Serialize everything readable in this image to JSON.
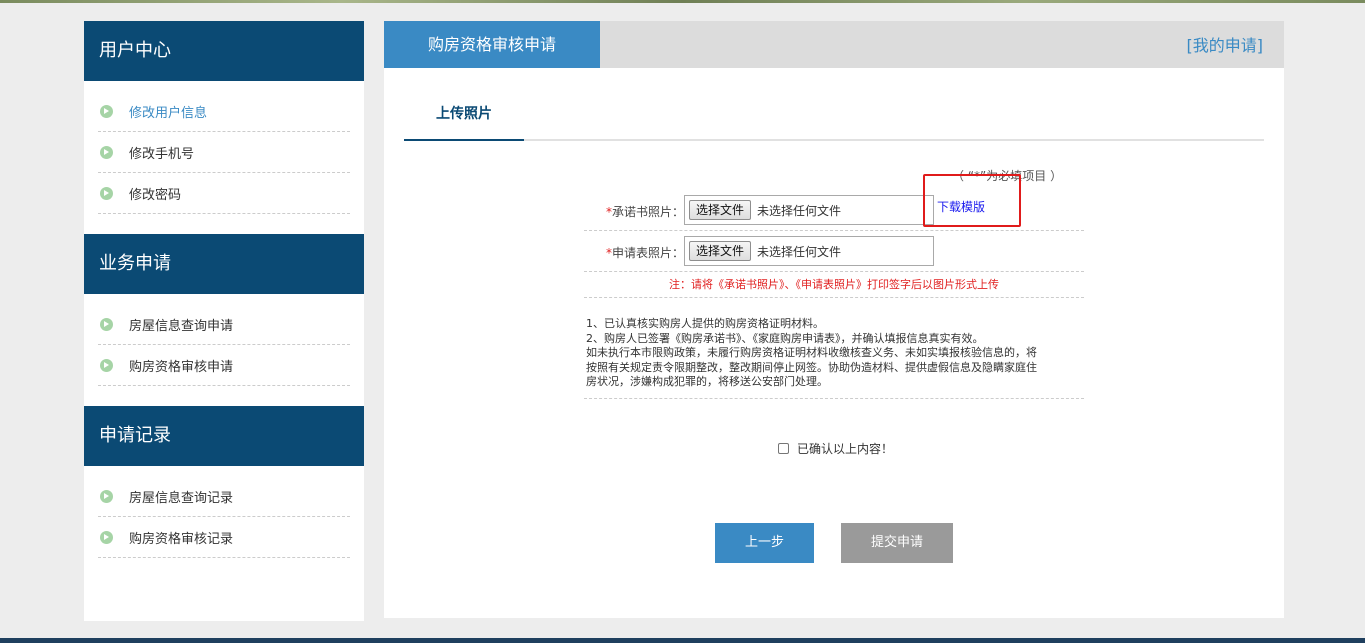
{
  "sidebar": {
    "sections": [
      {
        "title": "用户中心",
        "items": [
          "修改用户信息",
          "修改手机号",
          "修改密码"
        ]
      },
      {
        "title": "业务申请",
        "items": [
          "房屋信息查询申请",
          "购房资格审核申请"
        ]
      },
      {
        "title": "申请记录",
        "items": [
          "房屋信息查询记录",
          "购房资格审核记录"
        ]
      }
    ]
  },
  "main": {
    "tab_title": "购房资格审核申请",
    "my_apply": "[我的申请]",
    "subtab": "上传照片",
    "required_note": "（ “*”为必填项目 ）",
    "fields": [
      {
        "star": "*",
        "label": "承诺书照片：",
        "button": "选择文件",
        "status": "未选择任何文件"
      },
      {
        "star": "*",
        "label": "申请表照片：",
        "button": "选择文件",
        "status": "未选择任何文件"
      }
    ],
    "download_link": "下载模版",
    "warning": "注：请将《承诺书照片》、《申请表照片》打印签字后以图片形式上传",
    "notice_lines": [
      "1、已认真核实购房人提供的购房资格证明材料。",
      "2、购房人已签署《购房承诺书》、《家庭购房申请表》，并确认填报信息真实有效。",
      "如未执行本市限购政策，未履行购房资格证明材料收缴核查义务、未如实填报核验信息的，将",
      "按照有关规定责令限期整改，整改期间停止网签。协助伪造材料、提供虚假信息及隐瞒家庭住",
      "房状况，涉嫌构成犯罪的，将移送公安部门处理。"
    ],
    "confirm_label": "已确认以上内容！",
    "prev_button": "上一步",
    "submit_button": "提交申请"
  },
  "colors": {
    "sidebar_header": "#0b4a74",
    "accent": "#3a8ac4",
    "warning": "#e02020",
    "disabled_button": "#9a9a9a"
  }
}
